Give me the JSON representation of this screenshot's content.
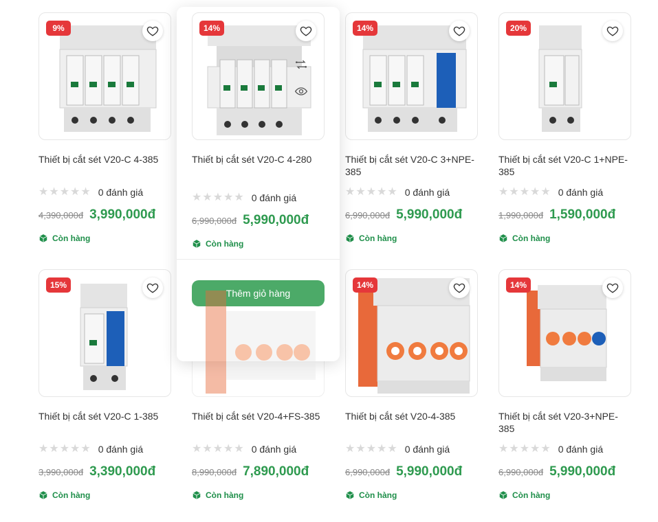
{
  "icons": {
    "wishlist": "heart-icon",
    "compare": "compare-arrows-icon",
    "quickview": "eye-icon",
    "stock": "box-icon",
    "rating": "star-icon"
  },
  "colors": {
    "badge": "#e5373a",
    "price": "#2e9a4f",
    "stock": "#1f8f4a",
    "cart_button": "#4caa68"
  },
  "products": [
    {
      "discount": "9%",
      "title": "Thiết bị cắt sét V20-C 4-385",
      "rating_text": "0 đánh giá",
      "stars": 0,
      "old_price": "4,390,000đ",
      "price": "3,990,000đ",
      "stock": "Còn hàng"
    },
    {
      "discount": "14%",
      "title": "Thiết bị cắt sét V20-C 4-280",
      "rating_text": "0 đánh giá",
      "stars": 0,
      "old_price": "6,990,000đ",
      "price": "5,990,000đ",
      "stock": "Còn hàng"
    },
    {
      "discount": "14%",
      "title": "Thiết bị cắt sét V20-C 3+NPE-385",
      "rating_text": "0 đánh giá",
      "stars": 0,
      "old_price": "6,990,000đ",
      "price": "5,990,000đ",
      "stock": "Còn hàng"
    },
    {
      "discount": "20%",
      "title": "Thiết bị cắt sét V20-C 1+NPE-385",
      "rating_text": "0 đánh giá",
      "stars": 0,
      "old_price": "1,990,000đ",
      "price": "1,590,000đ",
      "stock": "Còn hàng"
    },
    {
      "discount": "15%",
      "title": "Thiết bị cắt sét V20-C 1-385",
      "rating_text": "0 đánh giá",
      "stars": 0,
      "old_price": "3,990,000đ",
      "price": "3,390,000đ",
      "stock": "Còn hàng"
    },
    {
      "discount": "",
      "title": "Thiết bị cắt sét V20-4+FS-385",
      "rating_text": "0 đánh giá",
      "stars": 0,
      "old_price": "8,990,000đ",
      "price": "7,890,000đ",
      "stock": "Còn hàng"
    },
    {
      "discount": "14%",
      "title": "Thiết bị cắt sét V20-4-385",
      "rating_text": "0 đánh giá",
      "stars": 0,
      "old_price": "6,990,000đ",
      "price": "5,990,000đ",
      "stock": "Còn hàng"
    },
    {
      "discount": "14%",
      "title": "Thiết bị cắt sét V20-3+NPE-385",
      "rating_text": "0 đánh giá",
      "stars": 0,
      "old_price": "6,990,000đ",
      "price": "5,990,000đ",
      "stock": "Còn hàng"
    }
  ],
  "hover": {
    "cart_button": "Thêm giỏ hàng"
  }
}
